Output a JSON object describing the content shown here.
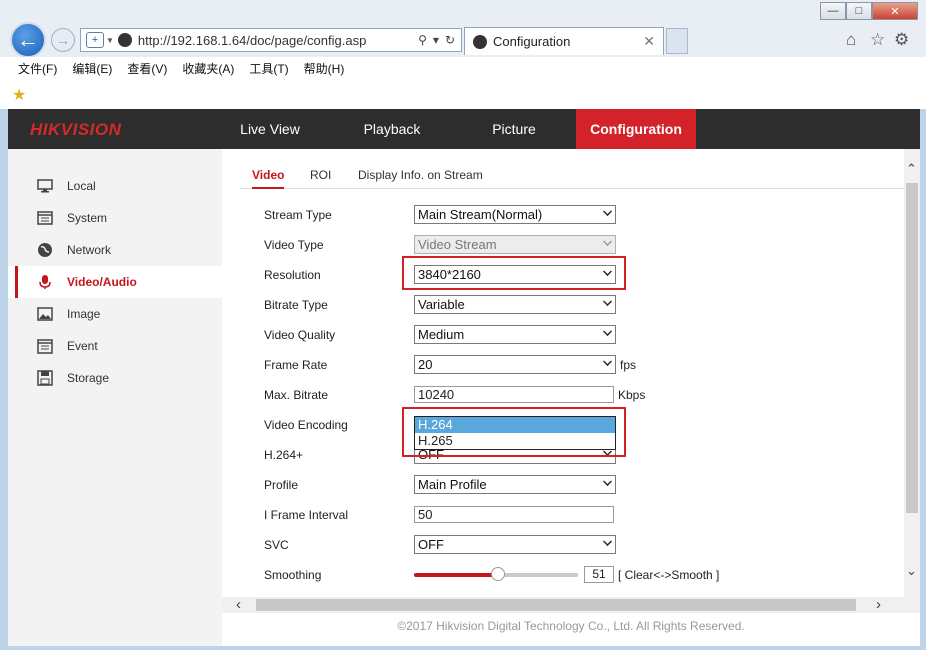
{
  "browser": {
    "url": "http://192.168.1.64/doc/page/config.asp",
    "tab_title": "Configuration",
    "menu": [
      "文件(F)",
      "编辑(E)",
      "查看(V)",
      "收藏夹(A)",
      "工具(T)",
      "帮助(H)"
    ]
  },
  "header": {
    "logo": "HIKVISION",
    "nav": [
      "Live View",
      "Playback",
      "Picture",
      "Configuration"
    ],
    "active_nav": "Configuration"
  },
  "sidebar": {
    "items": [
      {
        "label": "Local",
        "icon": "monitor-icon"
      },
      {
        "label": "System",
        "icon": "system-icon"
      },
      {
        "label": "Network",
        "icon": "globe-icon"
      },
      {
        "label": "Video/Audio",
        "icon": "microphone-icon"
      },
      {
        "label": "Image",
        "icon": "image-icon"
      },
      {
        "label": "Event",
        "icon": "calendar-icon"
      },
      {
        "label": "Storage",
        "icon": "storage-icon"
      }
    ],
    "active": "Video/Audio"
  },
  "subtabs": [
    "Video",
    "ROI",
    "Display Info. on Stream"
  ],
  "form": {
    "stream_type": {
      "label": "Stream Type",
      "value": "Main Stream(Normal)"
    },
    "video_type": {
      "label": "Video Type",
      "value": "Video Stream"
    },
    "resolution": {
      "label": "Resolution",
      "value": "3840*2160"
    },
    "bitrate_type": {
      "label": "Bitrate Type",
      "value": "Variable"
    },
    "video_quality": {
      "label": "Video Quality",
      "value": "Medium"
    },
    "frame_rate": {
      "label": "Frame Rate",
      "value": "20",
      "unit": "fps"
    },
    "max_bitrate": {
      "label": "Max. Bitrate",
      "value": "10240",
      "unit": "Kbps"
    },
    "video_encoding": {
      "label": "Video Encoding",
      "options": [
        "H.264",
        "H.265"
      ],
      "selected": "H.264"
    },
    "h264plus": {
      "label": "H.264+",
      "value": "OFF"
    },
    "profile": {
      "label": "Profile",
      "value": "Main Profile"
    },
    "i_frame_interval": {
      "label": "I Frame Interval",
      "value": "50"
    },
    "svc": {
      "label": "SVC",
      "value": "OFF"
    },
    "smoothing": {
      "label": "Smoothing",
      "value": "51",
      "hint": "[ Clear<->Smooth ]"
    }
  },
  "footer": "©2017 Hikvision Digital Technology Co., Ltd. All Rights Reserved.",
  "colors": {
    "accent": "#d4222a",
    "highlight": "#59a7dc"
  }
}
